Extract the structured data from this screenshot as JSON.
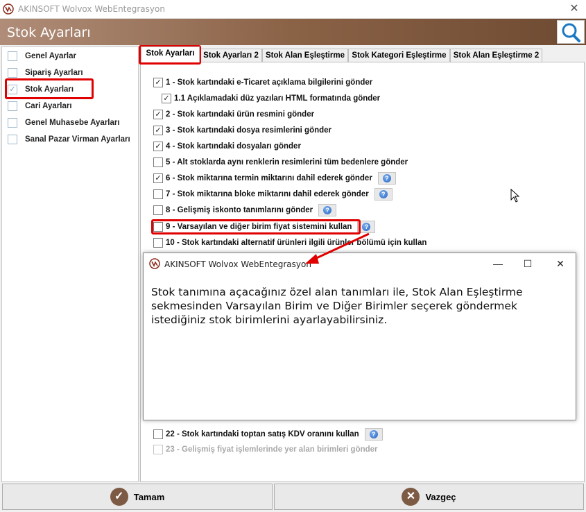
{
  "window": {
    "title": "AKINSOFT Wolvox WebEntegrasyon",
    "close_glyph": "✕"
  },
  "header": {
    "title": "Stok Ayarları",
    "search_icon": "magnifier-icon"
  },
  "sidebar": {
    "items": [
      {
        "label": "Genel Ayarlar",
        "checked": false
      },
      {
        "label": "Sipariş Ayarları",
        "checked": false
      },
      {
        "label": "Stok Ayarları",
        "checked": true
      },
      {
        "label": "Cari Ayarları",
        "checked": false
      },
      {
        "label": "Genel Muhasebe Ayarları",
        "checked": false
      },
      {
        "label": "Sanal Pazar Virman Ayarları",
        "checked": false
      }
    ]
  },
  "tabs": [
    {
      "label": "Stok Ayarları",
      "active": true
    },
    {
      "label": "Stok Ayarları 2",
      "active": false
    },
    {
      "label": "Stok Alan Eşleştirme",
      "active": false
    },
    {
      "label": "Stok Kategori Eşleştirme",
      "active": false
    },
    {
      "label": "Stok Alan Eşleştirme 2",
      "active": false
    }
  ],
  "options": [
    {
      "label": "1 - Stok kartındaki e-Ticaret açıklama bilgilerini gönder",
      "checked": true,
      "help": false
    },
    {
      "label": "1.1 Açıklamadaki düz yazıları HTML formatında gönder",
      "checked": true,
      "help": false
    },
    {
      "label": "2 - Stok kartındaki ürün resmini gönder",
      "checked": true,
      "help": false
    },
    {
      "label": "3 - Stok kartındaki dosya resimlerini gönder",
      "checked": true,
      "help": false
    },
    {
      "label": "4 - Stok kartındaki dosyaları gönder",
      "checked": true,
      "help": false
    },
    {
      "label": "5 - Alt stoklarda aynı renklerin resimlerini tüm bedenlere gönder",
      "checked": false,
      "help": false
    },
    {
      "label": "6 - Stok miktarına termin miktarını dahil ederek gönder",
      "checked": true,
      "help": true
    },
    {
      "label": "7 - Stok miktarına bloke miktarını dahil ederek gönder",
      "checked": false,
      "help": true
    },
    {
      "label": "8 - Gelişmiş iskonto tanımlarını gönder",
      "checked": false,
      "help": true
    },
    {
      "label": "9 - Varsayılan ve diğer birim fiyat sistemini kullan",
      "checked": false,
      "help": true
    },
    {
      "label": "10 - Stok kartındaki alternatif ürünleri ilgili ürünler bölümü için kullan",
      "checked": false,
      "help": false
    },
    {
      "label": "22 - Stok kartındaki toptan satış KDV oranını kullan",
      "checked": false,
      "help": true
    },
    {
      "label": "23 - Gelişmiş fiyat işlemlerinde yer alan birimleri gönder",
      "checked": false,
      "help": false,
      "disabled": true
    }
  ],
  "dialog": {
    "title": "AKINSOFT Wolvox WebEntegrasyon",
    "minimize": "—",
    "maximize": "☐",
    "close": "✕",
    "message": "Stok tanımına açacağınız özel alan tanımları ile, Stok Alan Eşleştirme sekmesinden Varsayılan Birim ve Diğer Birimler seçerek göndermek istediğiniz stok birimlerini ayarlayabilirsiniz."
  },
  "footer": {
    "ok_label": "Tamam",
    "ok_icon": "checkmark-icon",
    "cancel_label": "Vazgeç",
    "cancel_icon": "x-icon"
  },
  "colors": {
    "header_brown": "#8a6246",
    "highlight_red": "#e00000",
    "help_blue": "#1f5fc4"
  }
}
